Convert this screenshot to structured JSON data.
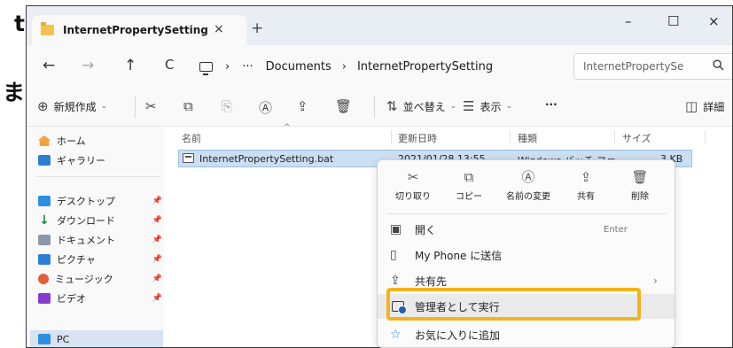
{
  "background_fragments": [
    "t",
    "ま"
  ],
  "titlebar": {
    "tab_title": "InternetPropertySetting",
    "tab_close": "×",
    "new_tab": "+",
    "minimize": "–",
    "maximize": "☐",
    "close": "×"
  },
  "address_bar": {
    "back": "←",
    "forward": "→",
    "up": "↑",
    "refresh": "C",
    "path_chevron": "›",
    "more": "···",
    "path": [
      "Documents",
      "InternetPropertySetting"
    ],
    "search_placeholder": "InternetPropertySe",
    "search_icon": "search-icon"
  },
  "command_bar": {
    "new_label": "新規作成",
    "sort_label": "並べ替え",
    "view_label": "表示",
    "more": "···",
    "details_label": "詳細",
    "dropdown": "⌄"
  },
  "sidebar": {
    "pin": "📌",
    "items": [
      {
        "label": "ホーム",
        "color": "#f2a33a"
      },
      {
        "label": "ギャラリー",
        "color": "#2a7fd4"
      },
      {
        "label": "デスクトップ",
        "color": "#2e8fe0"
      },
      {
        "label": "ダウンロード",
        "color": "#1e8a3a"
      },
      {
        "label": "ドキュメント",
        "color": "#8a97a8"
      },
      {
        "label": "ピクチャ",
        "color": "#2a7fd4"
      },
      {
        "label": "ミュージック",
        "color": "#e25f3a"
      },
      {
        "label": "ビデオ",
        "color": "#8a3ad0"
      }
    ],
    "pc_label": "PC"
  },
  "content": {
    "columns": [
      "名前",
      "更新日時",
      "種類",
      "サイズ"
    ],
    "sort_caret": "^",
    "files": [
      {
        "name": "InternetPropertySetting.bat",
        "modified": "2021/01/28 13:55",
        "type": "Windows バッチ ファ...",
        "size": "3 KB"
      }
    ]
  },
  "context_menu": {
    "quick_actions": [
      {
        "label": "切り取り",
        "glyph": "✂"
      },
      {
        "label": "コピー",
        "glyph": "⧉"
      },
      {
        "label": "名前の変更",
        "glyph": "Ⓐ"
      },
      {
        "label": "共有",
        "glyph": "⇪"
      },
      {
        "label": "削除",
        "glyph": "🗑"
      }
    ],
    "items": [
      {
        "label": "開く",
        "shortcut": "Enter"
      },
      {
        "label": "My Phone に送信"
      },
      {
        "label": "共有先",
        "submenu": "›"
      },
      {
        "label": "管理者として実行"
      },
      {
        "label": "お気に入りに追加"
      }
    ]
  },
  "colors": {
    "highlight": "#f5b31b",
    "selection": "#ccdff2",
    "accent": "#1f5fb0"
  }
}
